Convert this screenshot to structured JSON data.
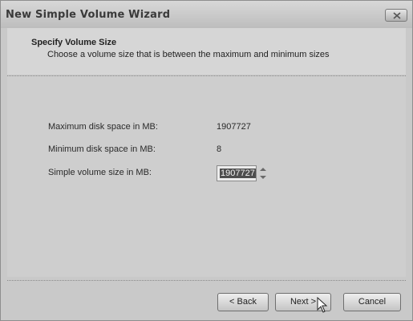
{
  "window": {
    "title": "New Simple Volume Wizard"
  },
  "header": {
    "title": "Specify Volume Size",
    "subtitle": "Choose a volume size that is between the maximum and minimum sizes"
  },
  "form": {
    "max_label": "Maximum disk space in MB:",
    "max_value": "1907727",
    "min_label": "Minimum disk space in MB:",
    "min_value": "8",
    "size_label": "Simple volume size in MB:",
    "size_value": "1907727"
  },
  "buttons": {
    "back": "< Back",
    "next": "Next >",
    "cancel": "Cancel"
  },
  "icons": {
    "close": "close-icon",
    "spin_up": "chevron-up-icon",
    "spin_down": "chevron-down-icon",
    "cursor": "mouse-pointer-icon"
  }
}
